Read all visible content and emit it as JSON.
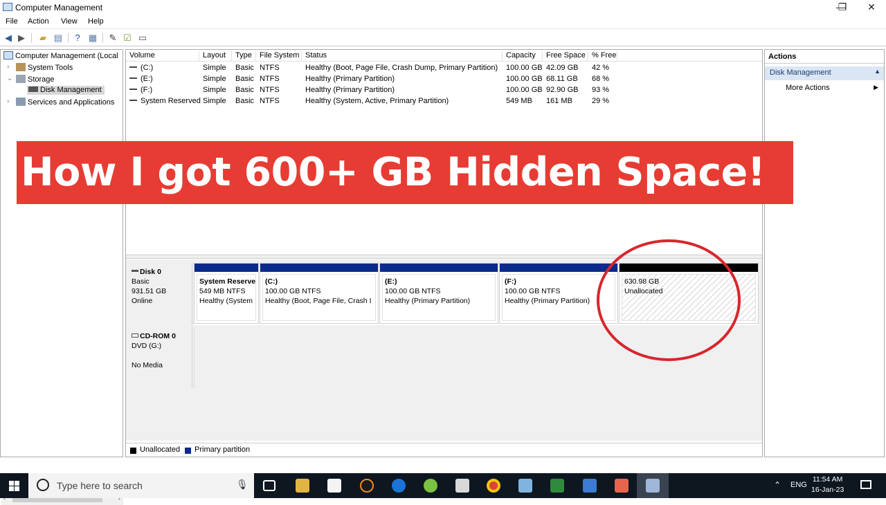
{
  "window": {
    "title": "Computer Management",
    "min": "—",
    "max": "❐",
    "close": "✕"
  },
  "menu": [
    "File",
    "Action",
    "View",
    "Help"
  ],
  "tree": {
    "root": "Computer Management (Local",
    "system_tools": "System Tools",
    "storage": "Storage",
    "disk_management": "Disk Management",
    "services": "Services and Applications"
  },
  "volumes": {
    "columns": [
      "Volume",
      "Layout",
      "Type",
      "File System",
      "Status",
      "Capacity",
      "Free Space",
      "% Free"
    ],
    "rows": [
      [
        "(C:)",
        "Simple",
        "Basic",
        "NTFS",
        "Healthy (Boot, Page File, Crash Dump, Primary Partition)",
        "100.00 GB",
        "42.09 GB",
        "42 %"
      ],
      [
        "(E:)",
        "Simple",
        "Basic",
        "NTFS",
        "Healthy (Primary Partition)",
        "100.00 GB",
        "68.11 GB",
        "68 %"
      ],
      [
        "(F:)",
        "Simple",
        "Basic",
        "NTFS",
        "Healthy (Primary Partition)",
        "100.00 GB",
        "92.90 GB",
        "93 %"
      ],
      [
        "System Reserved",
        "Simple",
        "Basic",
        "NTFS",
        "Healthy (System, Active, Primary Partition)",
        "549 MB",
        "161 MB",
        "29 %"
      ]
    ]
  },
  "disk0": {
    "name": "Disk 0",
    "type": "Basic",
    "size": "931.51 GB",
    "state": "Online",
    "partitions": [
      {
        "name": "System Reserve",
        "size": "549 MB NTFS",
        "status": "Healthy (System"
      },
      {
        "name": "(C:)",
        "size": "100.00 GB NTFS",
        "status": "Healthy (Boot, Page File, Crash I"
      },
      {
        "name": "(E:)",
        "size": "100.00 GB NTFS",
        "status": "Healthy (Primary Partition)"
      },
      {
        "name": "(F:)",
        "size": "100.00 GB NTFS",
        "status": "Healthy (Primary Partition)"
      }
    ],
    "unallocated": {
      "size": "630.98 GB",
      "label": "Unallocated"
    }
  },
  "cdrom": {
    "name": "CD-ROM 0",
    "drive": "DVD (G:)",
    "media": "No Media"
  },
  "legend": {
    "unallocated": "Unallocated",
    "primary": "Primary partition",
    "unallocated_color": "#000000",
    "primary_color": "#0a2a8c"
  },
  "actions": {
    "header": "Actions",
    "section": "Disk Management",
    "more": "More Actions"
  },
  "banner": {
    "text": "How I got 600+ GB Hidden Space!",
    "color": "#e73c33"
  },
  "highlight_color": "#d8262d",
  "taskbar": {
    "search_placeholder": "Type here to search",
    "lang": "ENG",
    "time": "11:54 AM",
    "date": "16-Jan-23"
  }
}
